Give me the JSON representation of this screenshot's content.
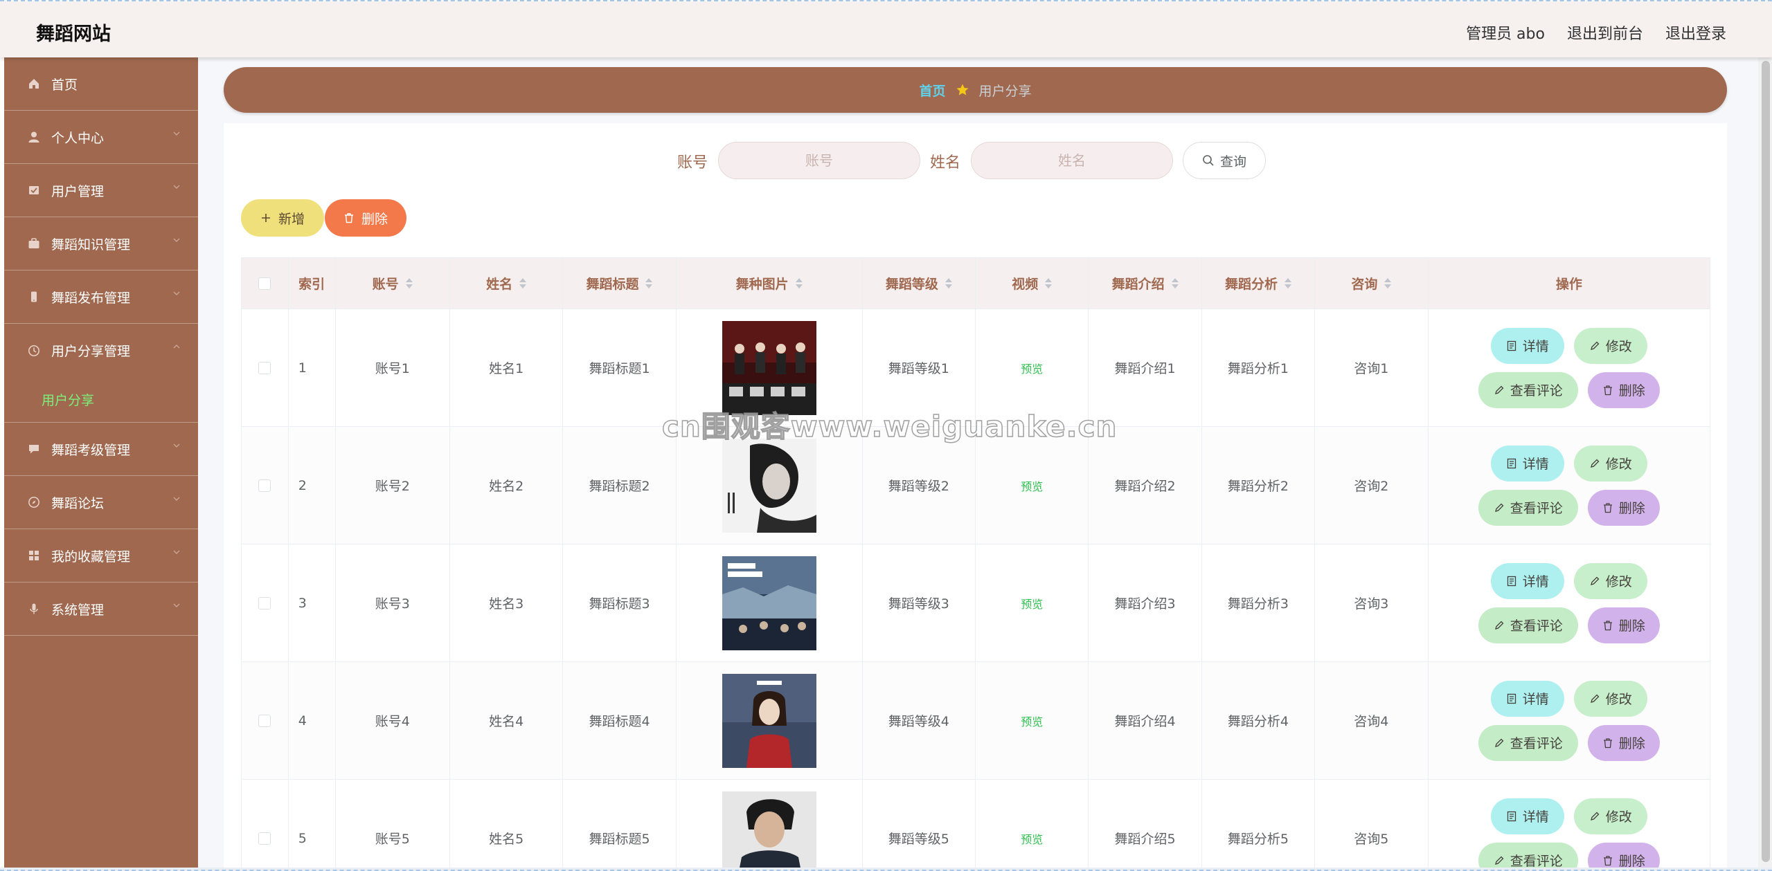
{
  "header": {
    "brand": "舞蹈网站",
    "admin_label": "管理员 abo",
    "to_front": "退出到前台",
    "logout": "退出登录"
  },
  "sidebar": {
    "items": [
      {
        "label": "首页",
        "icon": "home-icon"
      },
      {
        "label": "个人中心",
        "icon": "user-icon"
      },
      {
        "label": "用户管理",
        "icon": "users-icon"
      },
      {
        "label": "舞蹈知识管理",
        "icon": "briefcase-icon"
      },
      {
        "label": "舞蹈发布管理",
        "icon": "mobile-icon"
      },
      {
        "label": "用户分享管理",
        "icon": "clock-icon",
        "expanded": true
      },
      {
        "label": "舞蹈考级管理",
        "icon": "chat-icon"
      },
      {
        "label": "舞蹈论坛",
        "icon": "compass-icon"
      },
      {
        "label": "我的收藏管理",
        "icon": "grid-icon"
      },
      {
        "label": "系统管理",
        "icon": "mic-icon"
      }
    ],
    "subitem": "用户分享"
  },
  "breadcrumb": {
    "home": "首页",
    "current": "用户分享"
  },
  "search": {
    "account_label": "账号",
    "account_placeholder": "账号",
    "name_label": "姓名",
    "name_placeholder": "姓名",
    "query_button": "查询"
  },
  "actions": {
    "add": "新增",
    "delete": "删除"
  },
  "table": {
    "columns": [
      "索引",
      "账号",
      "姓名",
      "舞蹈标题",
      "舞种图片",
      "舞蹈等级",
      "视频",
      "舞蹈介绍",
      "舞蹈分析",
      "咨询",
      "操作"
    ],
    "rows": [
      {
        "index": "1",
        "account": "账号1",
        "name": "姓名1",
        "title": "舞蹈标题1",
        "level": "舞蹈等级1",
        "video": "预览",
        "intro": "舞蹈介绍1",
        "analysis": "舞蹈分析1",
        "consult": "咨询1"
      },
      {
        "index": "2",
        "account": "账号2",
        "name": "姓名2",
        "title": "舞蹈标题2",
        "level": "舞蹈等级2",
        "video": "预览",
        "intro": "舞蹈介绍2",
        "analysis": "舞蹈分析2",
        "consult": "咨询2"
      },
      {
        "index": "3",
        "account": "账号3",
        "name": "姓名3",
        "title": "舞蹈标题3",
        "level": "舞蹈等级3",
        "video": "预览",
        "intro": "舞蹈介绍3",
        "analysis": "舞蹈分析3",
        "consult": "咨询3"
      },
      {
        "index": "4",
        "account": "账号4",
        "name": "姓名4",
        "title": "舞蹈标题4",
        "level": "舞蹈等级4",
        "video": "预览",
        "intro": "舞蹈介绍4",
        "analysis": "舞蹈分析4",
        "consult": "咨询4"
      },
      {
        "index": "5",
        "account": "账号5",
        "name": "姓名5",
        "title": "舞蹈标题5",
        "level": "舞蹈等级5",
        "video": "预览",
        "intro": "舞蹈介绍5",
        "analysis": "舞蹈分析5",
        "consult": "咨询5"
      }
    ],
    "ops": {
      "detail": "详情",
      "edit": "修改",
      "comments": "查看评论",
      "delete": "删除"
    }
  },
  "watermark": "cn围观客www.weiguanke.cn",
  "colors": {
    "sidebar": "#a0694f",
    "header_bg": "#f6f0ef",
    "active_submenu": "#7cf07a",
    "breadcrumb_home": "#5fd2ee",
    "add_button": "#efe07c",
    "delete_button": "#f3794a",
    "op_detail": "#aef0ef",
    "op_edit": "#c8efcb",
    "op_delete": "#d2b2ea",
    "preview_link": "#2fbf4f"
  }
}
